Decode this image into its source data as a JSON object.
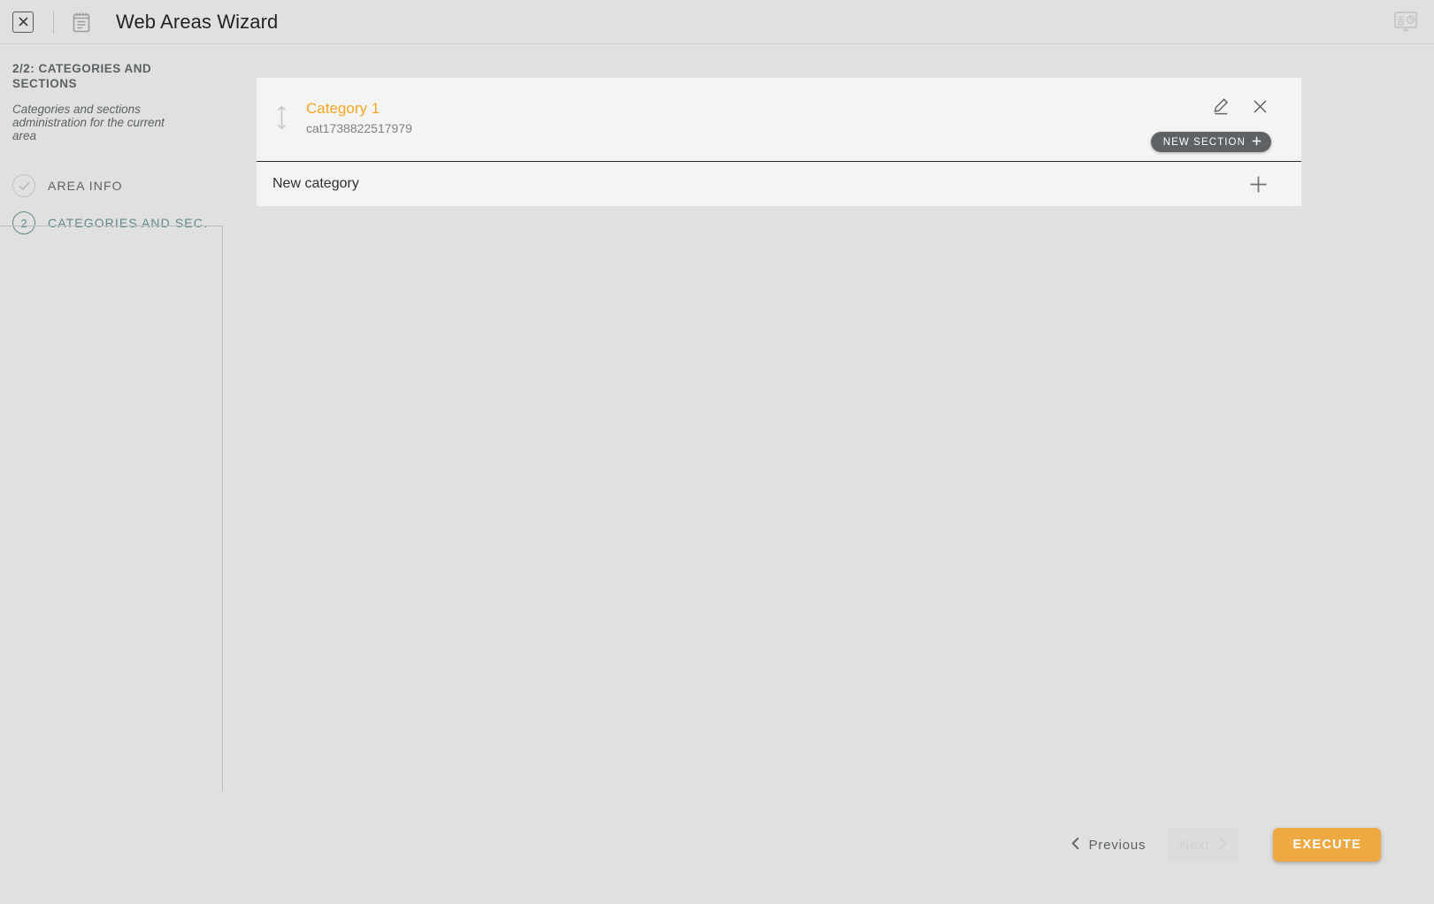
{
  "titlebar": {
    "close_label": "×",
    "close_icon": "close-box-icon",
    "doc_icon": "notepad-icon",
    "title": "Web Areas Wizard",
    "right_icon": "dashboard-monitor-icon"
  },
  "sidebar": {
    "step_title": "2/2: CATEGORIES AND SECTIONS",
    "description": "Categories and sections administration for the current area",
    "steps": [
      {
        "mark": "✓",
        "mark_icon": "check-icon",
        "label": "AREA INFO",
        "active": false
      },
      {
        "mark": "2",
        "mark_icon": "step-number-icon",
        "label": "CATEGORIES AND SEC…",
        "active": true
      }
    ]
  },
  "main": {
    "category": {
      "drag_icon": "reorder-vertical-arrows-icon",
      "name": "Category 1",
      "id": "cat1738822517979",
      "edit_icon": "pencil-edit-icon",
      "delete_icon": "close-x-icon",
      "new_section_label": "NEW SECTION",
      "new_section_icon": "plus-icon"
    },
    "new_category": {
      "label": "New category",
      "add_icon": "plus-icon"
    }
  },
  "footer": {
    "previous_label": "Previous",
    "previous_icon": "chevron-left-icon",
    "next_label": "Next",
    "next_icon": "chevron-right-icon",
    "execute_label": "EXECUTE"
  },
  "colors": {
    "accent_orange": "#F5A623",
    "execute_orange": "#EFA943",
    "active_teal": "#60898A",
    "page_bg": "#E0E0E0",
    "card_bg": "#F4F4F4",
    "pill_dark": "#5E6264"
  }
}
